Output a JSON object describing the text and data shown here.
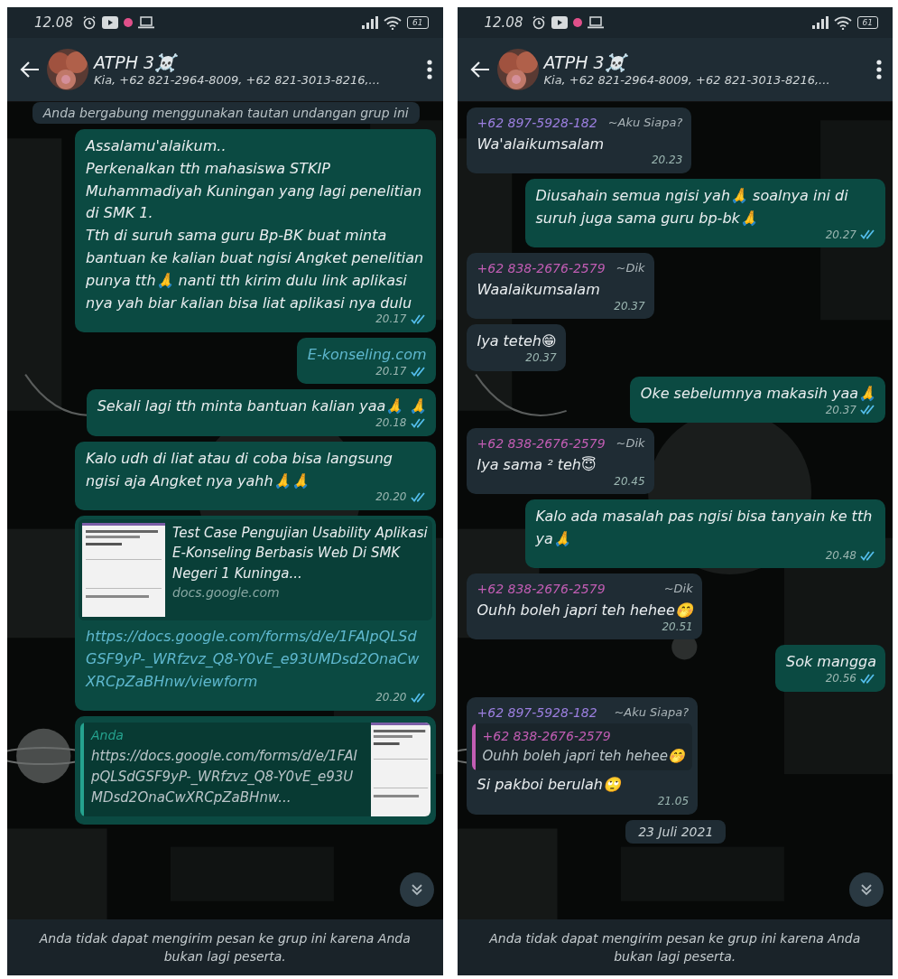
{
  "screens": [
    {
      "status_bar": {
        "time": "12.08",
        "battery": "61"
      },
      "header": {
        "title": "ATPH 3☠️",
        "subtitle": "Kia, +62 821-2964-8009, +62 821-3013-8216,..."
      },
      "messages": [
        {
          "kind": "system",
          "text": "Anda bergabung menggunakan tautan undangan grup ini"
        },
        {
          "kind": "out",
          "text": "Assalamu'alaikum..\nPerkenalkan tth mahasiswa STKIP Muhammadiyah Kuningan yang lagi penelitian di SMK 1.\nTth di suruh sama guru Bp-BK buat minta bantuan ke kalian buat ngisi Angket penelitian punya tth🙏 nanti tth kirim dulu link aplikasi nya yah biar kalian bisa liat aplikasi nya dulu",
          "time": "20.17",
          "read": true
        },
        {
          "kind": "link",
          "text": "E-konseling.com",
          "time": "20.17",
          "read": true
        },
        {
          "kind": "out",
          "text": "Sekali lagi tth minta bantuan kalian yaa🙏 🙏",
          "time": "20.18",
          "read": true
        },
        {
          "kind": "out",
          "text": "Kalo udh di liat atau di coba bisa langsung ngisi aja Angket nya yahh🙏🙏",
          "time": "20.20",
          "read": true
        },
        {
          "kind": "preview",
          "title": "Test Case Pengujian Usability Aplikasi E-Konseling Berbasis Web Di SMK Negeri 1 Kuninga...",
          "domain": "docs.google.com",
          "text": "https://docs.google.com/forms/d/e/1FAIpQLSdGSF9yP-_WRfzvz_Q8-Y0vE_e93UMDsd2OnaCwXRCpZaBHnw/viewform",
          "time": "20.20",
          "read": true
        },
        {
          "kind": "quote_cut",
          "quote_author": "Anda",
          "quote_text": "https://docs.google.com/forms/d/e/1FAIpQLSdGSF9yP-_WRfzvz_Q8-Y0vE_e93UMDsd2OnaCwXRCpZaBHnw..."
        }
      ],
      "footer": "Anda tidak dapat mengirim pesan ke grup ini karena Anda bukan lagi peserta."
    },
    {
      "status_bar": {
        "time": "12.08",
        "battery": "61"
      },
      "header": {
        "title": "ATPH 3☠️",
        "subtitle": "Kia, +62 821-2964-8009, +62 821-3013-8216,..."
      },
      "messages": [
        {
          "kind": "in",
          "sender": "+62 897-5928-182",
          "sender_tag": "~Aku Siapa?",
          "color": "#9c7fe0",
          "text": "Wa'alaikumsalam",
          "time": "20.23"
        },
        {
          "kind": "out",
          "text": "Diusahain semua ngisi yah🙏 soalnya ini di suruh juga sama guru bp-bk🙏",
          "time": "20.27",
          "read": true
        },
        {
          "kind": "in",
          "sender": "+62 838-2676-2579",
          "sender_tag": "~Dik",
          "color": "#c25db4",
          "text": "Waalaikumsalam",
          "time": "20.37"
        },
        {
          "kind": "in",
          "text": "Iya teteh😁",
          "time": "20.37"
        },
        {
          "kind": "out",
          "text": "Oke sebelumnya makasih yaa🙏",
          "time": "20.37",
          "read": true
        },
        {
          "kind": "in",
          "sender": "+62 838-2676-2579",
          "sender_tag": "~Dik",
          "color": "#c25db4",
          "text": "Iya sama ² teh😇",
          "time": "20.45"
        },
        {
          "kind": "out",
          "text": "Kalo ada masalah pas ngisi bisa tanyain ke tth ya🙏",
          "time": "20.48",
          "read": true
        },
        {
          "kind": "in",
          "sender": "+62 838-2676-2579",
          "sender_tag": "~Dik",
          "color": "#c25db4",
          "text": "Ouhh boleh japri teh hehee🤭",
          "time": "20.51"
        },
        {
          "kind": "out",
          "text": "Sok mangga",
          "time": "20.56",
          "read": true
        },
        {
          "kind": "reply_in",
          "sender": "+62 897-5928-182",
          "sender_tag": "~Aku Siapa?",
          "color": "#9c7fe0",
          "quote": {
            "author": "+62 838-2676-2579",
            "color": "#c25db4",
            "text": "Ouhh boleh japri teh hehee🤭"
          },
          "text": "Si pakboi berulah🙄",
          "time": "21.05"
        },
        {
          "kind": "date",
          "text": "23 Juli 2021"
        }
      ],
      "footer": "Anda tidak dapat mengirim pesan ke grup ini karena Anda bukan lagi peserta."
    }
  ]
}
